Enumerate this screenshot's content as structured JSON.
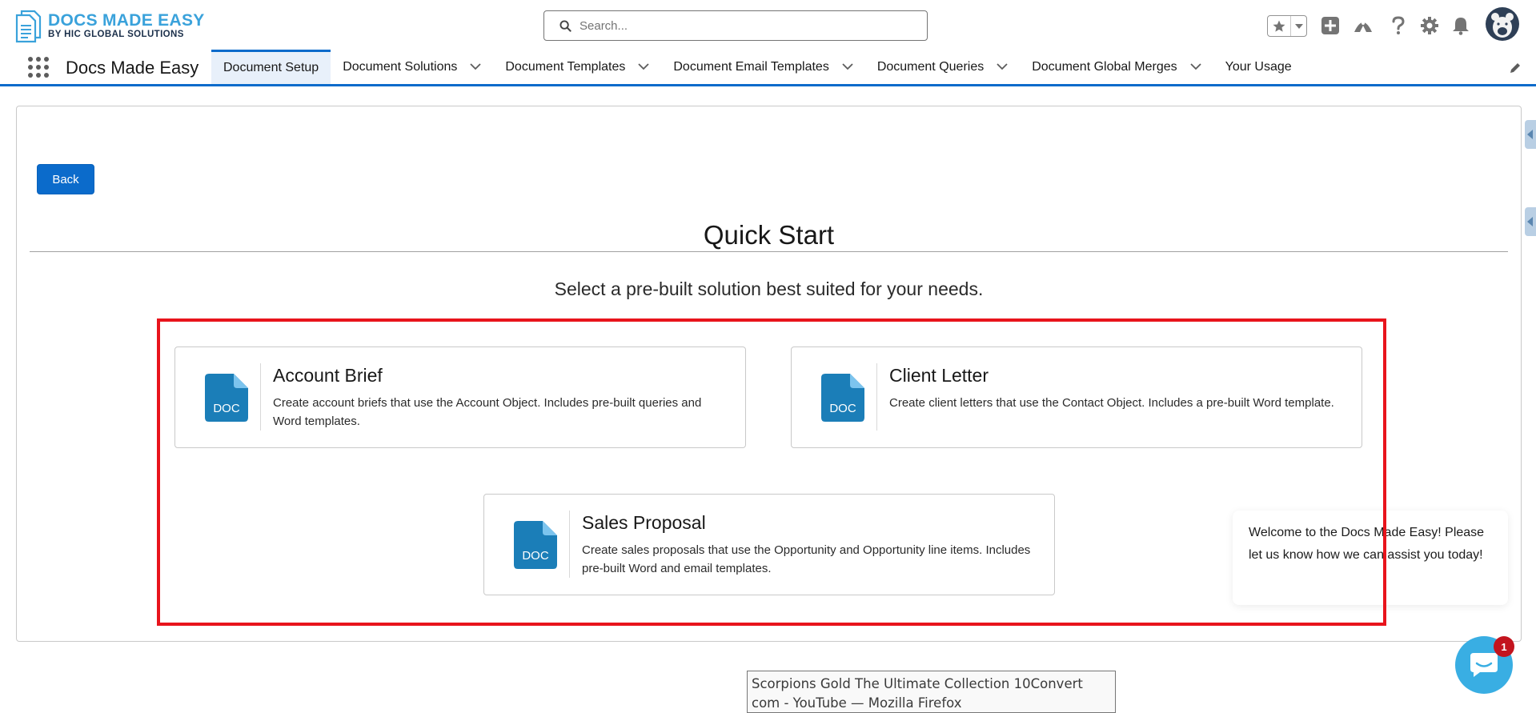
{
  "header": {
    "logo": {
      "line1": "DOCS MADE EASY",
      "line2": "BY HIC GLOBAL SOLUTIONS"
    },
    "search": {
      "placeholder": "Search..."
    },
    "icons": [
      "star-icon",
      "chevron-down-icon",
      "add-icon",
      "trailhead-icon",
      "help-icon",
      "setup-gear-icon",
      "notification-bell-icon",
      "avatar"
    ]
  },
  "nav": {
    "app_name": "Docs Made Easy",
    "tabs": [
      {
        "label": "Document Setup",
        "active": true,
        "dropdown": false
      },
      {
        "label": "Document Solutions",
        "active": false,
        "dropdown": true
      },
      {
        "label": "Document Templates",
        "active": false,
        "dropdown": true
      },
      {
        "label": "Document Email Templates",
        "active": false,
        "dropdown": true
      },
      {
        "label": "Document Queries",
        "active": false,
        "dropdown": true
      },
      {
        "label": "Document Global Merges",
        "active": false,
        "dropdown": true
      },
      {
        "label": "Your Usage",
        "active": false,
        "dropdown": false
      }
    ]
  },
  "main": {
    "back_label": "Back",
    "title": "Quick Start",
    "subtitle": "Select a pre-built solution best suited for your needs.",
    "doc_icon_label": "DOC",
    "cards": [
      {
        "title": "Account Brief",
        "description": "Create account briefs that use the Account Object. Includes pre-built queries and Word templates."
      },
      {
        "title": "Client Letter",
        "description": "Create client letters that use the Contact Object. Includes a pre-built Word template."
      },
      {
        "title": "Sales Proposal",
        "description": "Create sales proposals that use the Opportunity and Opportunity line items. Includes pre-built Word and email templates."
      }
    ]
  },
  "chat": {
    "message": "Welcome to the Docs Made Easy! Please let us know how we can assist you today!",
    "badge_count": "1"
  },
  "tooltip": {
    "text": "Scorpions Gold The Ultimate Collection 10Convert com - YouTube — Mozilla Firefox"
  },
  "colors": {
    "brand_blue": "#0b6bcb",
    "logo_blue": "#3aa2db",
    "doc_icon": "#1b7eb8",
    "highlight_red": "#e8141c",
    "chat_blue": "#39aee3",
    "badge_red": "#c3141e"
  }
}
